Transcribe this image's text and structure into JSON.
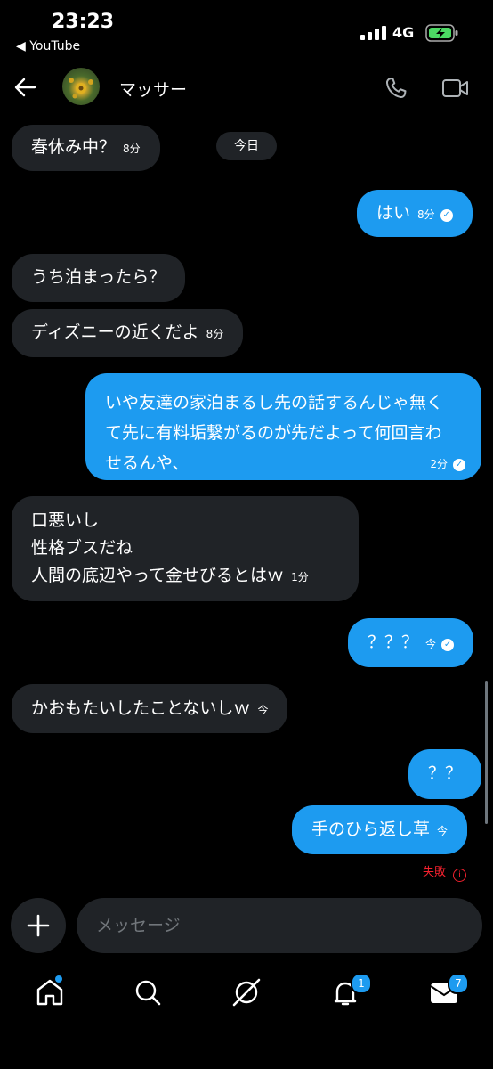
{
  "status_bar": {
    "time": "23:23",
    "back_app": "◀ YouTube",
    "network": "4G"
  },
  "header": {
    "contact_name": "マッサー"
  },
  "date_chip": "今日",
  "messages": [
    {
      "text": "春休み中？",
      "time": "8分"
    },
    {
      "text": "はい",
      "time": "8分"
    },
    {
      "text": "うち泊まったら？",
      "time": ""
    },
    {
      "text": "ディズニーの近くだよ",
      "time": "8分"
    },
    {
      "text": "いや友達の家泊まるし先の話するんじゃ無くて先に有料垢繋がるのが先だよって何回言わせるんや、",
      "time": "2分"
    },
    {
      "text_lines": [
        "口悪いし",
        "性格ブスだね",
        "人間の底辺やって金せびるとはｗ"
      ],
      "time": "1分"
    },
    {
      "text": "？？？",
      "time": "今"
    },
    {
      "text": "かおもたいしたことないしｗ",
      "time": "今"
    },
    {
      "text": "？？",
      "time": ""
    },
    {
      "text": "手のひら返し草",
      "time": "今"
    }
  ],
  "failed_label": "失敗",
  "composer": {
    "placeholder": "メッセージ"
  },
  "nav": {
    "notifications_badge": "1",
    "messages_badge": "7"
  },
  "colors": {
    "accent": "#1d9bf0",
    "incoming_bubble": "#202327",
    "error": "#f4212e"
  }
}
